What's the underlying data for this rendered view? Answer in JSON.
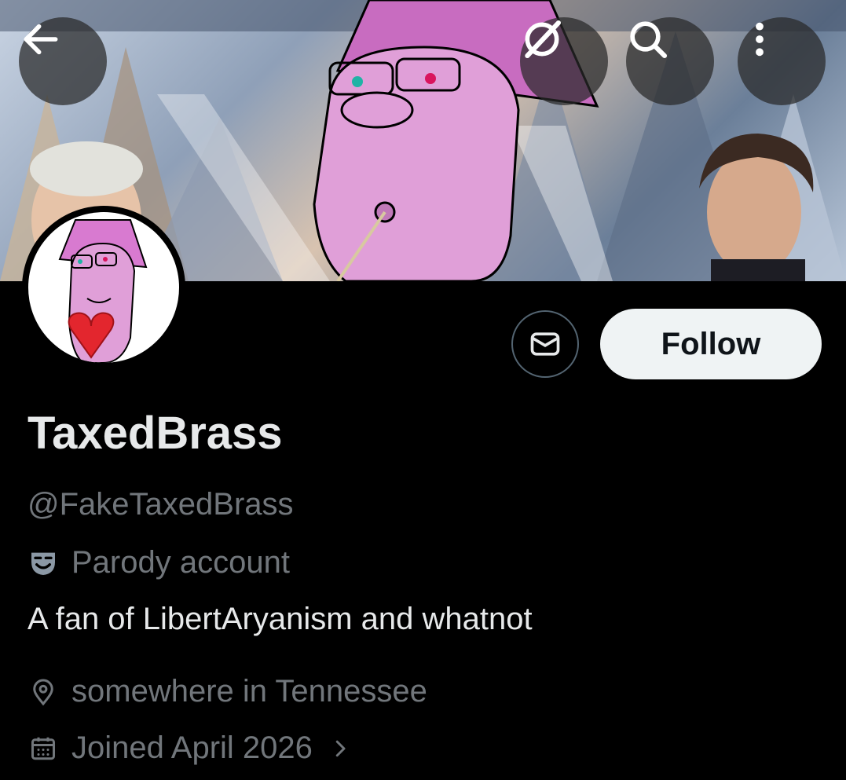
{
  "header": {
    "buttons": [
      {
        "name": "back",
        "icon": "arrow-left-icon"
      },
      {
        "name": "grok",
        "icon": "grok-icon"
      },
      {
        "name": "search",
        "icon": "search-icon"
      },
      {
        "name": "more",
        "icon": "more-vertical-icon"
      }
    ]
  },
  "profile": {
    "display_name": "TaxedBrass",
    "handle": "@FakeTaxedBrass",
    "parody_label": "Parody account",
    "bio": "A fan of LibertAryanism and whatnot",
    "location": "somewhere in Tennessee",
    "joined": "Joined April 2026"
  },
  "actions": {
    "follow_label": "Follow",
    "message_icon": "envelope-icon"
  },
  "colors": {
    "background": "#000000",
    "primary_text": "#e7e9ea",
    "secondary_text": "#71767b",
    "follow_bg": "#eff3f4",
    "avatar_character": "#e09fd8"
  }
}
